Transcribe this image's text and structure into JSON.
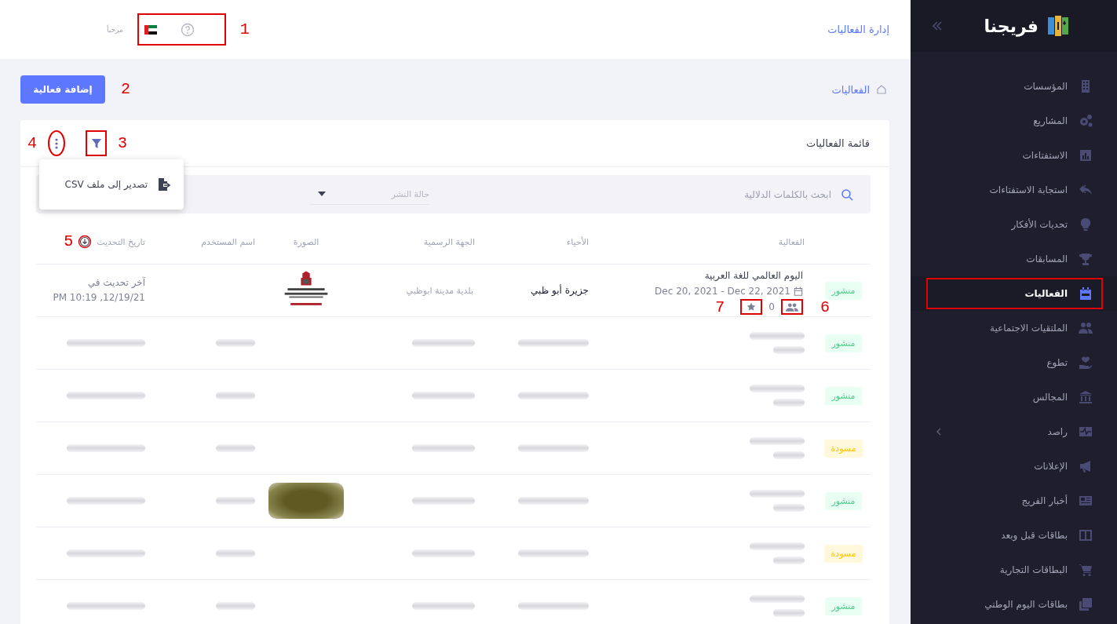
{
  "sidebar": {
    "brand": "فريجنا",
    "items": [
      {
        "label": "المؤسسات",
        "selected": false,
        "highlighted": false,
        "expandable": false
      },
      {
        "label": "المشاريع",
        "selected": false,
        "highlighted": false,
        "expandable": false
      },
      {
        "label": "الاستفتاءات",
        "selected": false,
        "highlighted": false,
        "expandable": false
      },
      {
        "label": "استجابة الاستفتاءات",
        "selected": false,
        "highlighted": false,
        "expandable": false
      },
      {
        "label": "تحديات الأفكار",
        "selected": false,
        "highlighted": false,
        "expandable": false
      },
      {
        "label": "المسابقات",
        "selected": false,
        "highlighted": false,
        "expandable": false
      },
      {
        "label": "الفعاليات",
        "selected": true,
        "highlighted": true,
        "expandable": false
      },
      {
        "label": "الملتقيات الاجتماعية",
        "selected": false,
        "highlighted": false,
        "expandable": false
      },
      {
        "label": "تطوع",
        "selected": false,
        "highlighted": false,
        "expandable": false
      },
      {
        "label": "المجالس",
        "selected": false,
        "highlighted": false,
        "expandable": false
      },
      {
        "label": "راصد",
        "selected": false,
        "highlighted": false,
        "expandable": true
      },
      {
        "label": "الإعلانات",
        "selected": false,
        "highlighted": false,
        "expandable": false
      },
      {
        "label": "أخبار الفريج",
        "selected": false,
        "highlighted": false,
        "expandable": false
      },
      {
        "label": "بطاقات قبل وبعد",
        "selected": false,
        "highlighted": false,
        "expandable": false
      },
      {
        "label": "البطاقات التجارية",
        "selected": false,
        "highlighted": false,
        "expandable": false
      },
      {
        "label": "بطاقات اليوم الوطني",
        "selected": false,
        "highlighted": false,
        "expandable": false
      }
    ]
  },
  "header": {
    "title": "إدارة الفعاليات",
    "greeting": "مرحباً",
    "callout": "1"
  },
  "toolbar": {
    "breadcrumb": "الفعاليات",
    "add_button": {
      "label": "إضافة فعالية",
      "callout": "2"
    }
  },
  "card": {
    "title": "قائمة الفعاليات",
    "filter_button": {
      "callout": "3"
    },
    "more_button": {
      "callout": "4"
    },
    "menu": {
      "items": [
        {
          "label": "تصدير إلى ملف CSV"
        }
      ]
    },
    "search": {
      "placeholder": "ابحث بالكلمات الدلالية"
    },
    "status_select": {
      "placeholder": "حالة النشر"
    }
  },
  "table": {
    "columns": [
      {
        "label": "الفعالية",
        "sorted": false
      },
      {
        "label": "الأحياء",
        "sorted": false
      },
      {
        "label": "الجهة الرسمية",
        "sorted": false
      },
      {
        "label": "الصورة",
        "sorted": false
      },
      {
        "label": "اسم المستخدم",
        "sorted": false
      },
      {
        "label": "تاريخ التحديث",
        "sorted": true,
        "callout": "5"
      }
    ],
    "rows": [
      {
        "status": "منشور",
        "kind": "published",
        "blurred": false,
        "event": "اليوم العالمي للغة العربية",
        "dates": "Dec 20, 2021 - Dec 22, 2021",
        "attendees_count": "0",
        "attendees_callout": "6",
        "favorite_callout": "7",
        "neighborhood": "جزيرة أبو ظبي",
        "authority": "بلدية مدينة ابوظبي",
        "updated_label": "آخر تحديث في",
        "updated_at": "12/19/21, 10:19 PM"
      },
      {
        "status": "منشور",
        "kind": "published",
        "blurred": true,
        "photo": false
      },
      {
        "status": "منشور",
        "kind": "published",
        "blurred": true,
        "photo": false
      },
      {
        "status": "مسودة",
        "kind": "draft",
        "blurred": true,
        "photo": false
      },
      {
        "status": "منشور",
        "kind": "published",
        "blurred": true,
        "photo": true
      },
      {
        "status": "مسودة",
        "kind": "draft",
        "blurred": true,
        "photo": false
      },
      {
        "status": "منشور",
        "kind": "published",
        "blurred": true,
        "photo": false
      }
    ]
  }
}
